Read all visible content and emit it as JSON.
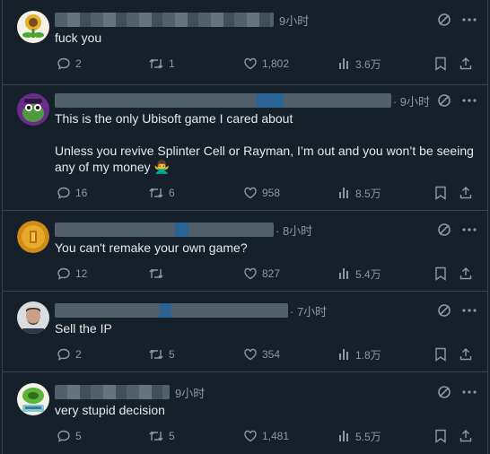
{
  "posts": [
    {
      "id": "post-1",
      "time": "9小时",
      "text": "fuck you",
      "replies": "2",
      "retweets": "1",
      "likes": "1,802",
      "views": "3.6万",
      "avatar_icon": "plant-avatar-icon"
    },
    {
      "id": "post-2",
      "time": "· 9小时",
      "text": "This is the only Ubisoft game I cared about\n\nUnless you revive Splinter Cell or Rayman, I’m out and you won’t be seeing any of my money 🙅‍♂️",
      "replies": "16",
      "retweets": "6",
      "likes": "958",
      "views": "8.5万",
      "avatar_icon": "frog-avatar-icon"
    },
    {
      "id": "post-3",
      "time": "· 8小时",
      "text": "You can't remake your own game?",
      "replies": "12",
      "retweets": "",
      "likes": "827",
      "views": "5.4万",
      "avatar_icon": "gold-coin-avatar-icon"
    },
    {
      "id": "post-4",
      "time": "· 7小时",
      "text": "Sell the IP",
      "replies": "2",
      "retweets": "5",
      "likes": "354",
      "views": "1.8万",
      "avatar_icon": "person-avatar-icon"
    },
    {
      "id": "post-5",
      "time": "9小时",
      "text": "very stupid decision",
      "replies": "5",
      "retweets": "5",
      "likes": "1,481",
      "views": "5.5万",
      "avatar_icon": "plant-avatar-icon"
    }
  ],
  "colors": {
    "background": "#15202b",
    "border": "#38444d",
    "text_primary": "#e7e9ea",
    "text_secondary": "#8b98a5"
  }
}
